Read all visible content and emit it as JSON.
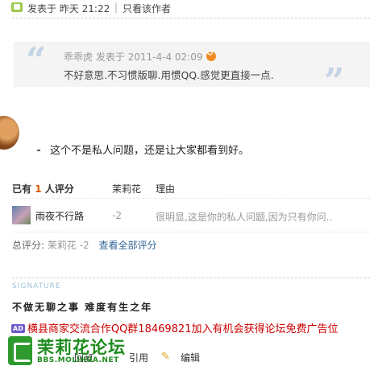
{
  "header": {
    "posted": "发表于 昨天 21:22",
    "separator": "|",
    "only_author": "只看该作者"
  },
  "quote": {
    "meta": "乖乖虎 发表于 2011-4-4 02:09",
    "text": "不好意思.不习惯版聊.用惯QQ.感觉更直接一点."
  },
  "reply": {
    "text": "这个不是私人问题，还是让大家都看到好。"
  },
  "rating": {
    "header_prefix": "已有",
    "count": "1",
    "header_suffix": "人评分",
    "col_flower": "茉莉花",
    "col_reason": "理由",
    "rows": [
      {
        "user": "雨夜不行路",
        "score": "-2",
        "reason": "很明显,这是你的私人问题,因为只有你问.."
      }
    ],
    "total_label": "总评分:",
    "total_value": "茉莉花 -2",
    "view_all": "查看全部评分"
  },
  "signature": {
    "label": "SIGNATURE",
    "text": "不做无聊之事  难度有生之年",
    "ad_badge": "AD",
    "ad_text": "横县商家交流合作QQ群18469821加入有机会获得论坛免费广告位"
  },
  "actions": {
    "reply": "回复",
    "quote": "引用",
    "edit": "编辑"
  },
  "watermark": {
    "name": "茉莉花论坛",
    "url": "BBS.MOLIHUA.NET"
  },
  "colors": {
    "accent_link": "#336699",
    "ad_red": "#cc0000",
    "logo_green": "#1e8c1e",
    "count_orange": "#e05a00"
  }
}
